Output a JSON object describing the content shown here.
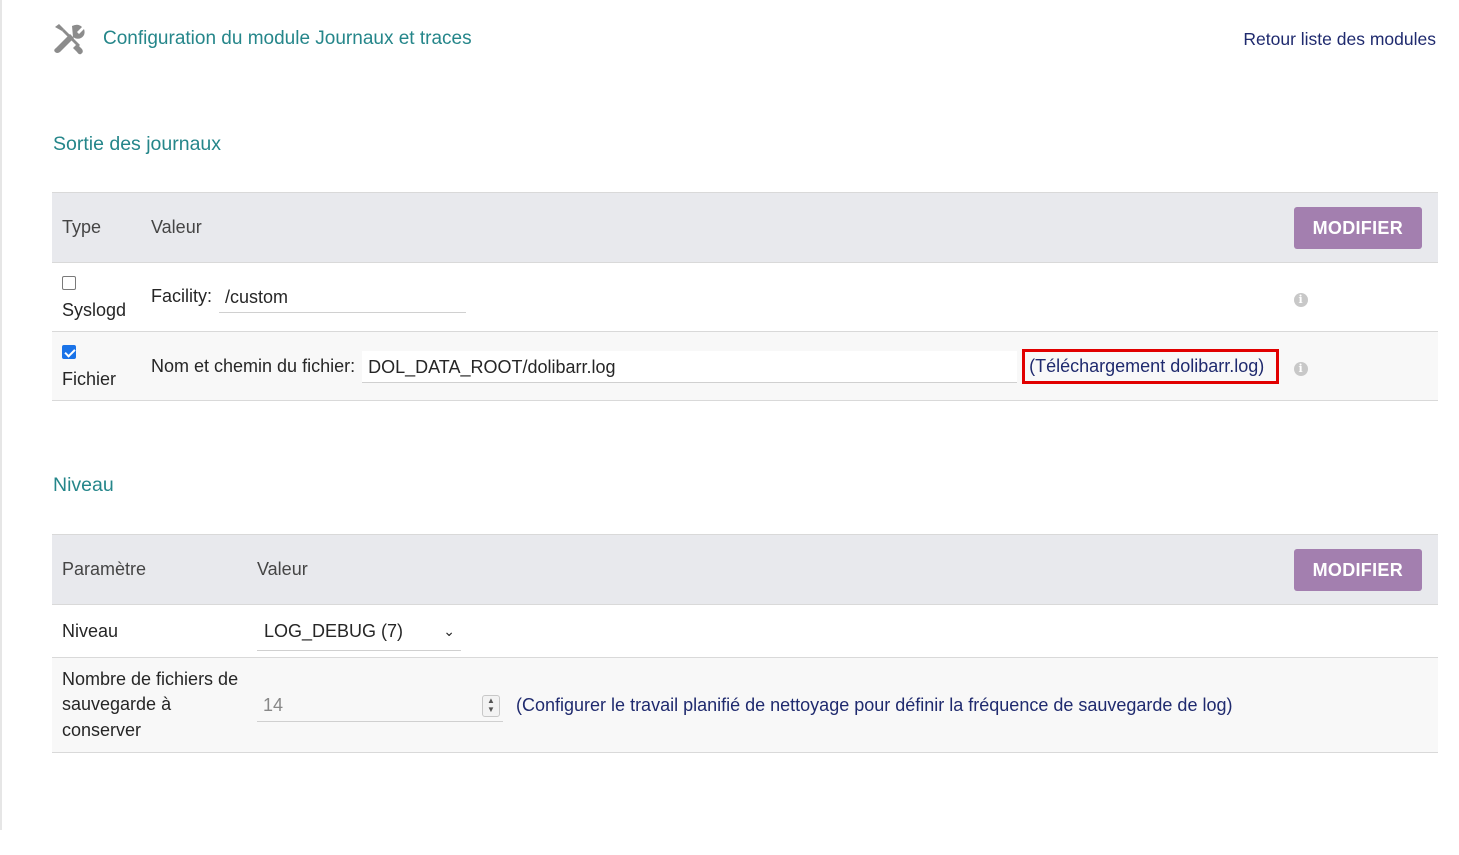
{
  "header": {
    "title": "Configuration du module Journaux et traces",
    "back_link": "Retour liste des modules"
  },
  "outputs": {
    "section_title": "Sortie des journaux",
    "columns": {
      "type": "Type",
      "value": "Valeur"
    },
    "modify_button": "MODIFIER",
    "rows": [
      {
        "type": "Syslogd",
        "checked": false,
        "field_label": "Facility:",
        "field_value": "/custom"
      },
      {
        "type": "Fichier",
        "checked": true,
        "field_label": "Nom et chemin du fichier:",
        "field_value": "DOL_DATA_ROOT/dolibarr.log",
        "download_link": "(Téléchargement dolibarr.log)"
      }
    ]
  },
  "level": {
    "section_title": "Niveau",
    "columns": {
      "param": "Paramètre",
      "value": "Valeur"
    },
    "modify_button": "MODIFIER",
    "level_label": "Niveau",
    "level_value": "LOG_DEBUG (7)",
    "backup_label": "Nombre de fichiers de sauvegarde à conserver",
    "backup_value": "14",
    "backup_help": "(Configurer le travail planifié de nettoyage pour définir la fréquence de sauvegarde de log)"
  },
  "colors": {
    "title": "#25868a",
    "link": "#1f2a6e",
    "button": "#a37faf",
    "highlight": "#e10000",
    "header_row": "#e8e9ed"
  }
}
